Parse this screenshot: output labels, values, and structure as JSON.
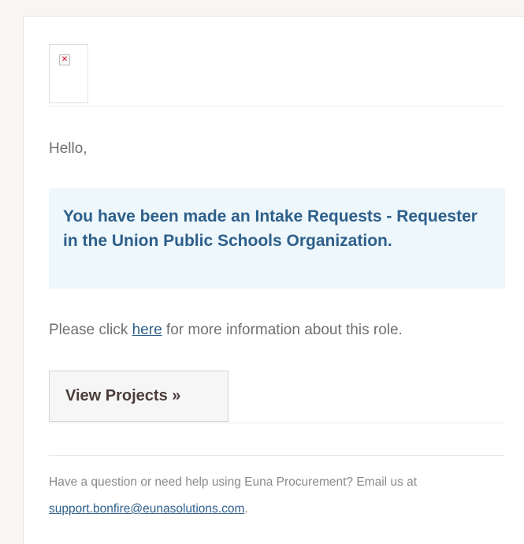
{
  "header": {
    "logo_icon": "broken-image-icon",
    "logo_glyph": "✕"
  },
  "greeting": "Hello,",
  "notice": {
    "text": "You have been made an Intake Requests - Requester in the Union Public Schools Organization."
  },
  "info": {
    "prefix": "Please click ",
    "link_text": "here",
    "suffix": " for more information about this role."
  },
  "cta": {
    "label": "View Projects »"
  },
  "footer": {
    "text": "Have a question or need help using Euna Procurement? Email us at ",
    "email": "support.bonfire@eunasolutions.com",
    "suffix": "."
  },
  "colors": {
    "accent": "#2d5f8b",
    "notice_background": "#eef7fb",
    "page_background": "#f8f6f3"
  }
}
